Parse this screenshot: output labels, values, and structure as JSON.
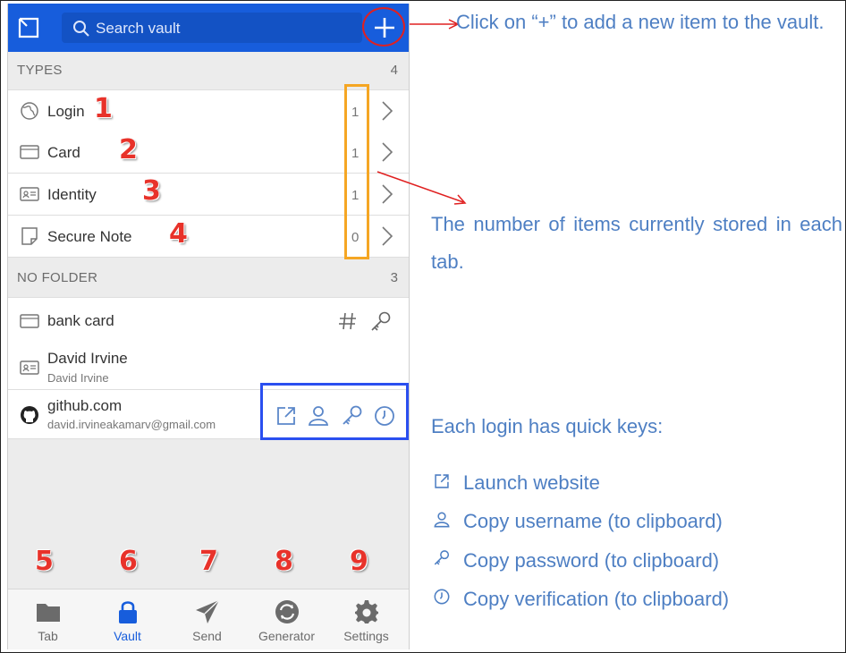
{
  "search": {
    "placeholder": "Search vault"
  },
  "types": {
    "title": "TYPES",
    "count": "4",
    "items": [
      {
        "label": "Login",
        "count": "1",
        "marker": "1"
      },
      {
        "label": "Card",
        "count": "1",
        "marker": "2"
      },
      {
        "label": "Identity",
        "count": "1",
        "marker": "3"
      },
      {
        "label": "Secure Note",
        "count": "0",
        "marker": "4"
      }
    ]
  },
  "no_folder": {
    "title": "NO FOLDER",
    "count": "3",
    "items": [
      {
        "label": "bank card",
        "sub": ""
      },
      {
        "label": "David Irvine",
        "sub": "David Irvine"
      },
      {
        "label": "github.com",
        "sub": "david.irvineakamarv@gmail.com"
      }
    ]
  },
  "nav": [
    {
      "label": "Tab",
      "marker": "5",
      "icon": "folder-icon"
    },
    {
      "label": "Vault",
      "marker": "6",
      "icon": "lock-icon"
    },
    {
      "label": "Send",
      "marker": "7",
      "icon": "send-icon"
    },
    {
      "label": "Generator",
      "marker": "8",
      "icon": "generator-icon"
    },
    {
      "label": "Settings",
      "marker": "9",
      "icon": "gear-icon"
    }
  ],
  "annotations": {
    "add": "Click on “+” to add a new item to the vault.",
    "count": "The number of items currently stored in each tab.",
    "quick_keys_title": "Each login has quick keys:",
    "quick_keys": [
      "Launch website",
      "Copy username (to clipboard)",
      "Copy password (to clipboard)",
      "Copy verification (to clipboard)"
    ]
  },
  "colors": {
    "brand": "#175ddc",
    "annotation": "#4e7fc3",
    "marker": "#e8322a",
    "orange_box": "#f5a623",
    "blue_box": "#2a4ff0"
  }
}
